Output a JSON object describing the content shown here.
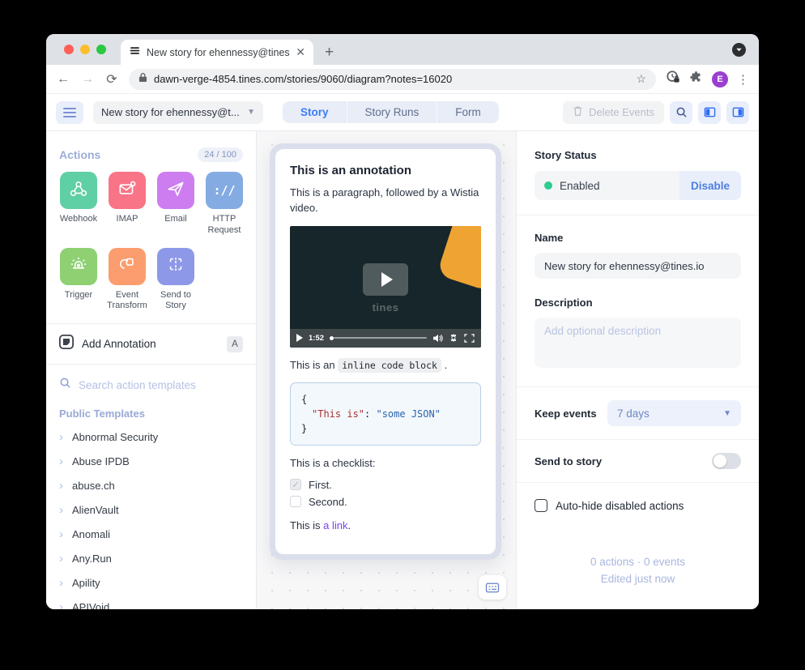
{
  "browser": {
    "tab_title": "New story for ehennessy@tines",
    "url": "dawn-verge-4854.tines.com/stories/9060/diagram?notes=16020",
    "avatar_letter": "E"
  },
  "toolbar": {
    "story_name": "New story for ehennessy@t...",
    "tabs": [
      {
        "label": "Story",
        "active": true
      },
      {
        "label": "Story Runs",
        "active": false
      },
      {
        "label": "Form",
        "active": false
      }
    ],
    "delete_events_label": "Delete Events"
  },
  "sidebar": {
    "actions_header": "Actions",
    "actions_count": "24 / 100",
    "tiles": [
      {
        "id": "webhook",
        "label": "Webhook",
        "color": "#5fcfa5"
      },
      {
        "id": "imap",
        "label": "IMAP",
        "color": "#f97487"
      },
      {
        "id": "email",
        "label": "Email",
        "color": "#cd7df0"
      },
      {
        "id": "http",
        "label": "HTTP Request",
        "color": "#84abe2"
      },
      {
        "id": "trigger",
        "label": "Trigger",
        "color": "#8ed072"
      },
      {
        "id": "transform",
        "label": "Event Transform",
        "color": "#fb9d6e"
      },
      {
        "id": "sendstory",
        "label": "Send to Story",
        "color": "#8d98e8"
      }
    ],
    "add_annotation_label": "Add Annotation",
    "add_annotation_shortcut": "A",
    "search_placeholder": "Search action templates",
    "templates_header": "Public Templates",
    "templates": [
      "Abnormal Security",
      "Abuse IPDB",
      "abuse.ch",
      "AlienVault",
      "Anomali",
      "Any.Run",
      "Apility",
      "APIVoid"
    ]
  },
  "canvas": {
    "annotation": {
      "title": "This is an annotation",
      "paragraph": "This is a paragraph, followed by a Wistia video.",
      "video": {
        "time": "1:52",
        "watermark": "tines"
      },
      "inline_prefix": "This is an ",
      "inline_code": "inline code block",
      "inline_suffix": " .",
      "json": {
        "open": "{",
        "key": "\"This is\"",
        "colon": ": ",
        "value": "\"some JSON\"",
        "close": "}"
      },
      "checklist_label": "This is a checklist:",
      "checklist": [
        {
          "label": "First.",
          "checked": true
        },
        {
          "label": "Second.",
          "checked": false
        }
      ],
      "link_prefix": "This is ",
      "link_text": "a link",
      "link_suffix": "."
    }
  },
  "inspector": {
    "status_header": "Story Status",
    "status_value": "Enabled",
    "disable_label": "Disable",
    "name_header": "Name",
    "name_value": "New story for ehennessy@tines.io",
    "description_header": "Description",
    "description_placeholder": "Add optional description",
    "keep_events_label": "Keep events",
    "keep_events_value": "7 days",
    "send_to_story_label": "Send to story",
    "autohide_label": "Auto-hide disabled actions",
    "counts": "0 actions  ·  0 events",
    "edited": "Edited just now"
  },
  "colors": {
    "accent_blue": "#3b7cf6",
    "status_green": "#2ecc8e",
    "link_purple": "#7a3ff2"
  }
}
